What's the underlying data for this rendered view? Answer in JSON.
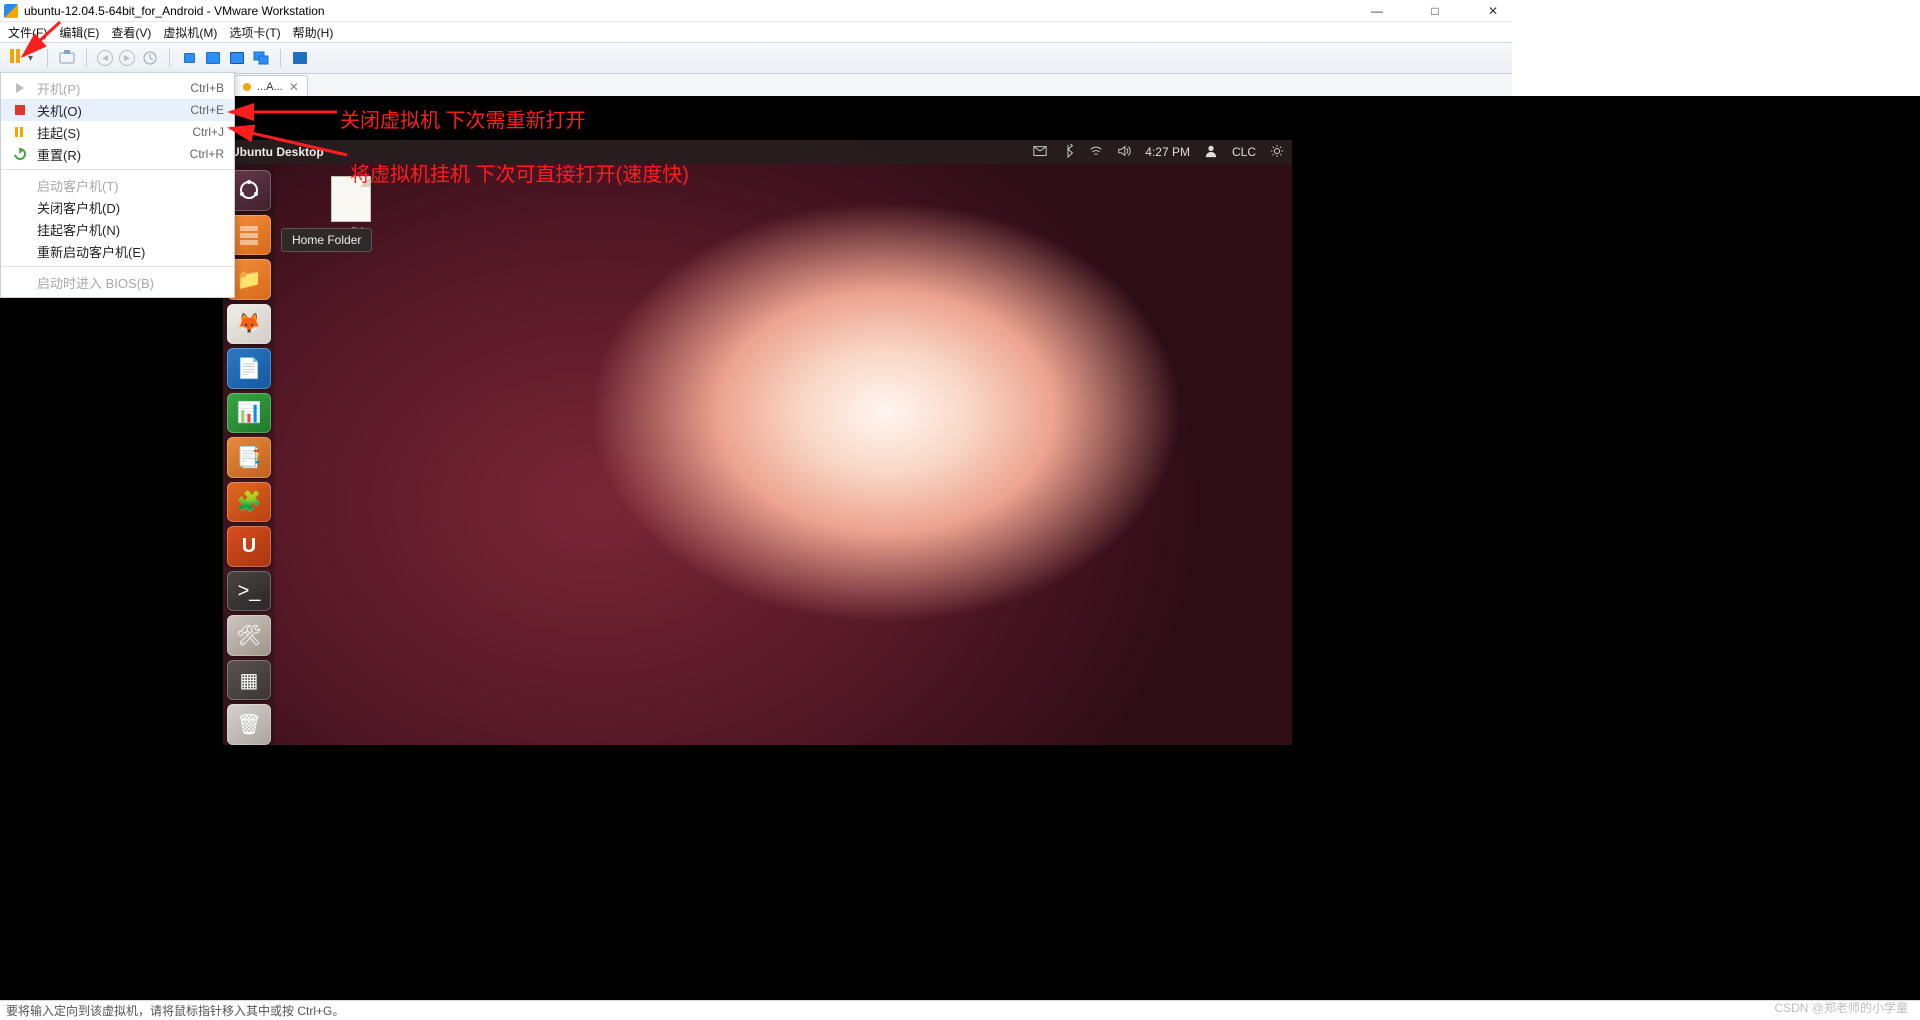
{
  "window": {
    "title": "ubuntu-12.04.5-64bit_for_Android - VMware Workstation",
    "controls": {
      "min": "—",
      "max": "□",
      "close": "✕"
    }
  },
  "menubar": [
    "文件(F)",
    "编辑(E)",
    "查看(V)",
    "虚拟机(M)",
    "选项卡(T)",
    "帮助(H)"
  ],
  "vm_tab": {
    "label": "...A...",
    "close": "✕"
  },
  "power_menu": {
    "items": [
      {
        "id": "poweron",
        "label": "开机(P)",
        "shortcut": "Ctrl+B",
        "disabled": true,
        "icon": "play"
      },
      {
        "id": "poweroff",
        "label": "关机(O)",
        "shortcut": "Ctrl+E",
        "disabled": false,
        "icon": "stop",
        "highlight": true
      },
      {
        "id": "suspend",
        "label": "挂起(S)",
        "shortcut": "Ctrl+J",
        "disabled": false,
        "icon": "pause"
      },
      {
        "id": "reset",
        "label": "重置(R)",
        "shortcut": "Ctrl+R",
        "disabled": false,
        "icon": "reset"
      }
    ],
    "sep1": true,
    "items2": [
      {
        "id": "guest-poweron",
        "label": "启动客户机(T)",
        "disabled": true
      },
      {
        "id": "guest-shutdown",
        "label": "关闭客户机(D)",
        "disabled": false
      },
      {
        "id": "guest-suspend",
        "label": "挂起客户机(N)",
        "disabled": false
      },
      {
        "id": "guest-restart",
        "label": "重新启动客户机(E)",
        "disabled": false
      }
    ],
    "sep2": true,
    "items3": [
      {
        "id": "bios",
        "label": "启动时进入 BIOS(B)",
        "disabled": true
      }
    ]
  },
  "ubuntu": {
    "panel_title": "Ubuntu Desktop",
    "time": "4:27 PM",
    "user": "CLC",
    "launcher": [
      {
        "id": "dash",
        "glyph": "◌"
      },
      {
        "id": "files",
        "glyph": "🗂"
      },
      {
        "id": "folder",
        "glyph": "📁"
      },
      {
        "id": "firefox",
        "glyph": "🦊"
      },
      {
        "id": "writer",
        "glyph": "📄"
      },
      {
        "id": "calc",
        "glyph": "📊"
      },
      {
        "id": "impress",
        "glyph": "📑"
      },
      {
        "id": "software",
        "glyph": "🧩"
      },
      {
        "id": "ubuntu-one",
        "glyph": "U"
      },
      {
        "id": "terminal",
        "glyph": ">_"
      },
      {
        "id": "settings",
        "glyph": "🛠"
      },
      {
        "id": "workspaces",
        "glyph": "▦"
      },
      {
        "id": "trash",
        "glyph": "🗑"
      }
    ],
    "desktop_file_label": "readMe",
    "tooltip": "Home Folder"
  },
  "annotations": {
    "a1": "关闭虚拟机 下次需重新打开",
    "a2": "将虚拟机挂机 下次可直接打开(速度快)"
  },
  "statusbar": "要将输入定向到该虚拟机，请将鼠标指针移入其中或按 Ctrl+G。",
  "watermark": "CSDN @郑老师的小学童"
}
